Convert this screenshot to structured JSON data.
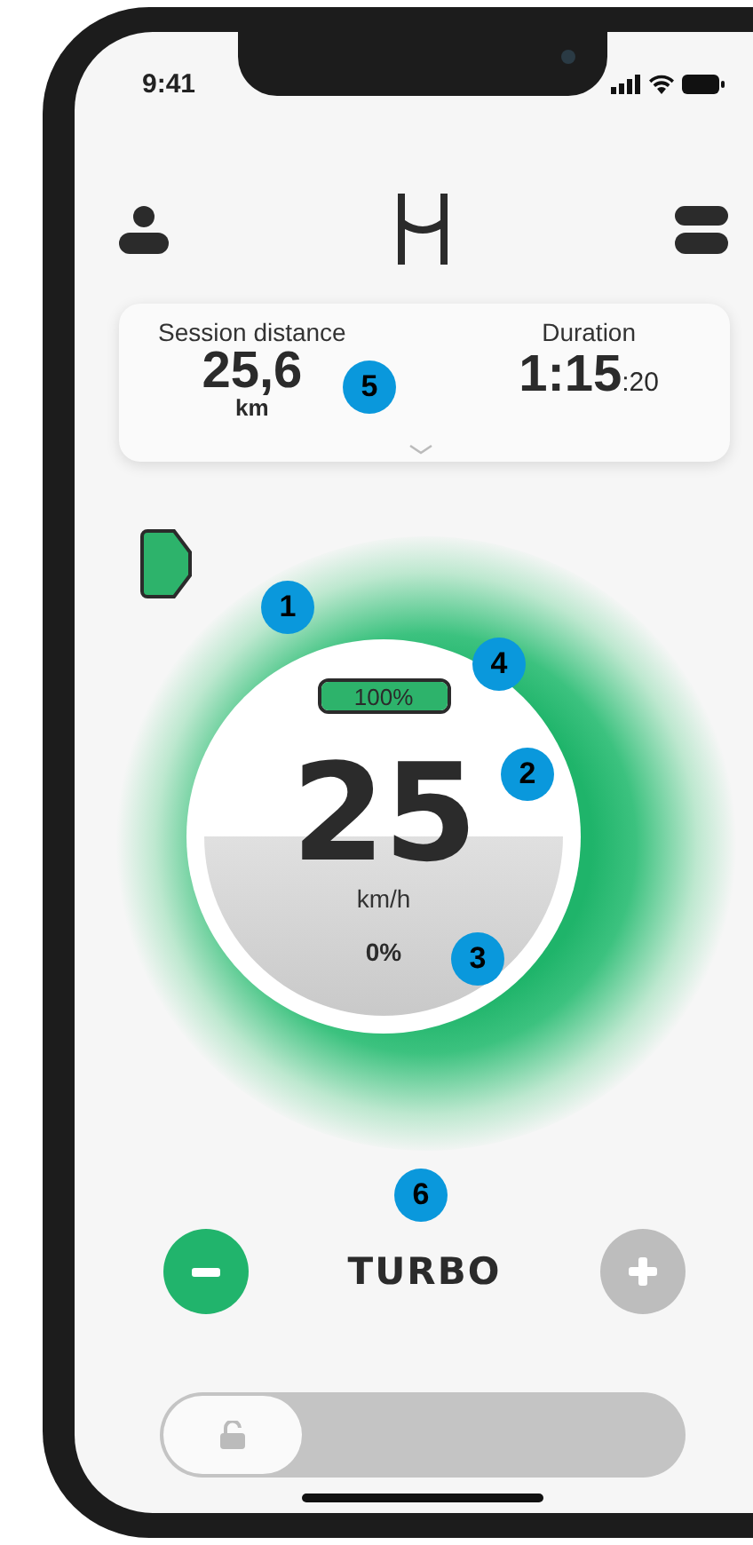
{
  "status_bar": {
    "time": "9:41"
  },
  "stats": [
    {
      "kind": "distance",
      "label": "Session distance",
      "value": "25,6",
      "unit": "km"
    },
    {
      "kind": "duration",
      "label": "Duration",
      "value": "1:15",
      "unit": ":20"
    }
  ],
  "gauge": {
    "battery": {
      "label": "100%",
      "level": 1
    },
    "speed": "25",
    "speed_unit": "km/h",
    "assist": "0%"
  },
  "mode": {
    "label": "TURBO",
    "decrease": {
      "disabled": false
    },
    "increase": {
      "disabled": true
    }
  },
  "unlock": {
    "level": 0
  },
  "callouts": [
    {
      "number": "5"
    },
    {
      "number": "1"
    },
    {
      "number": "4"
    },
    {
      "number": "2"
    },
    {
      "number": "3"
    },
    {
      "number": "6"
    }
  ]
}
